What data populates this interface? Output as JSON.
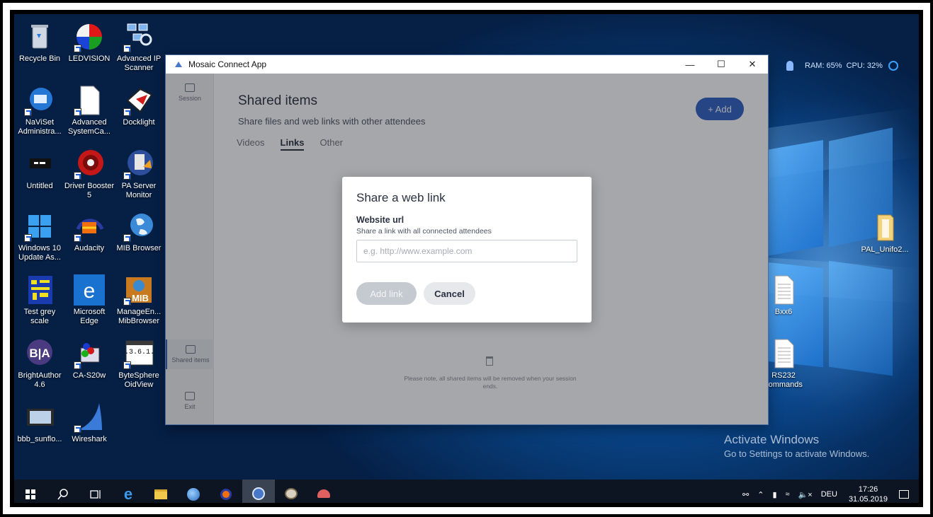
{
  "desktop": {
    "icons": [
      {
        "label": "Recycle Bin",
        "icon": "recycle-bin-icon"
      },
      {
        "label": "LEDVISION",
        "icon": "ledvision-icon"
      },
      {
        "label": "Advanced IP Scanner",
        "icon": "network-scanner-icon"
      },
      {
        "label": "NaViSet Administra...",
        "icon": "naviset-icon"
      },
      {
        "label": "Advanced SystemCa...",
        "icon": "document-icon"
      },
      {
        "label": "Docklight",
        "icon": "docklight-icon"
      },
      {
        "label": "Untitled",
        "icon": "untitled-icon"
      },
      {
        "label": "Driver Booster 5",
        "icon": "driver-booster-icon"
      },
      {
        "label": "PA Server Monitor",
        "icon": "pa-server-icon"
      },
      {
        "label": "Windows 10 Update As...",
        "icon": "windows-icon"
      },
      {
        "label": "Audacity",
        "icon": "audacity-icon"
      },
      {
        "label": "MIB Browser",
        "icon": "globe-icon"
      },
      {
        "label": "Test grey scale",
        "icon": "test-pattern-icon"
      },
      {
        "label": "Microsoft Edge",
        "icon": "edge-icon"
      },
      {
        "label": "ManageEn... MibBrowser",
        "icon": "mib-browser-icon"
      },
      {
        "label": "BrightAuthor 4.6",
        "icon": "brightauthor-icon"
      },
      {
        "label": "CA-S20w",
        "icon": "ca-s20w-icon"
      },
      {
        "label": "ByteSphere OidView",
        "icon": "oidview-icon"
      },
      {
        "label": "bbb_sunflo...",
        "icon": "video-file-icon"
      },
      {
        "label": "Wireshark",
        "icon": "wireshark-icon"
      }
    ],
    "right_icons": [
      {
        "label": "PAL_Unifo2...",
        "icon": "folder-icon"
      },
      {
        "label": "Bxx6",
        "icon": "text-file-icon"
      },
      {
        "label": "RS232 commands",
        "icon": "text-file-icon"
      }
    ],
    "widget": {
      "ram": "RAM: 65%",
      "cpu": "CPU: 32%"
    },
    "watermark": {
      "line1": "Activate Windows",
      "line2": "Go to Settings to activate Windows."
    }
  },
  "window": {
    "title": "Mosaic Connect App",
    "rail": [
      {
        "label": "Session",
        "active": false
      },
      {
        "label": "Shared items",
        "active": true
      },
      {
        "label": "Exit",
        "active": false
      }
    ],
    "heading": "Shared items",
    "subheading": "Share files and web links with other attendees",
    "tabs": [
      {
        "label": "Videos",
        "active": false
      },
      {
        "label": "Links",
        "active": true
      },
      {
        "label": "Other",
        "active": false
      }
    ],
    "add_button": "+ Add",
    "empty_note": "Please note, all shared items will be removed when your session ends."
  },
  "dialog": {
    "title": "Share a web link",
    "field_label": "Website url",
    "field_help": "Share a link with all connected attendees",
    "input_value": "",
    "input_placeholder": "e.g. http://www.example.com",
    "add_button": "Add link",
    "cancel_button": "Cancel"
  },
  "taskbar": {
    "language": "DEU",
    "time": "17:26",
    "date": "31.05.2019"
  }
}
